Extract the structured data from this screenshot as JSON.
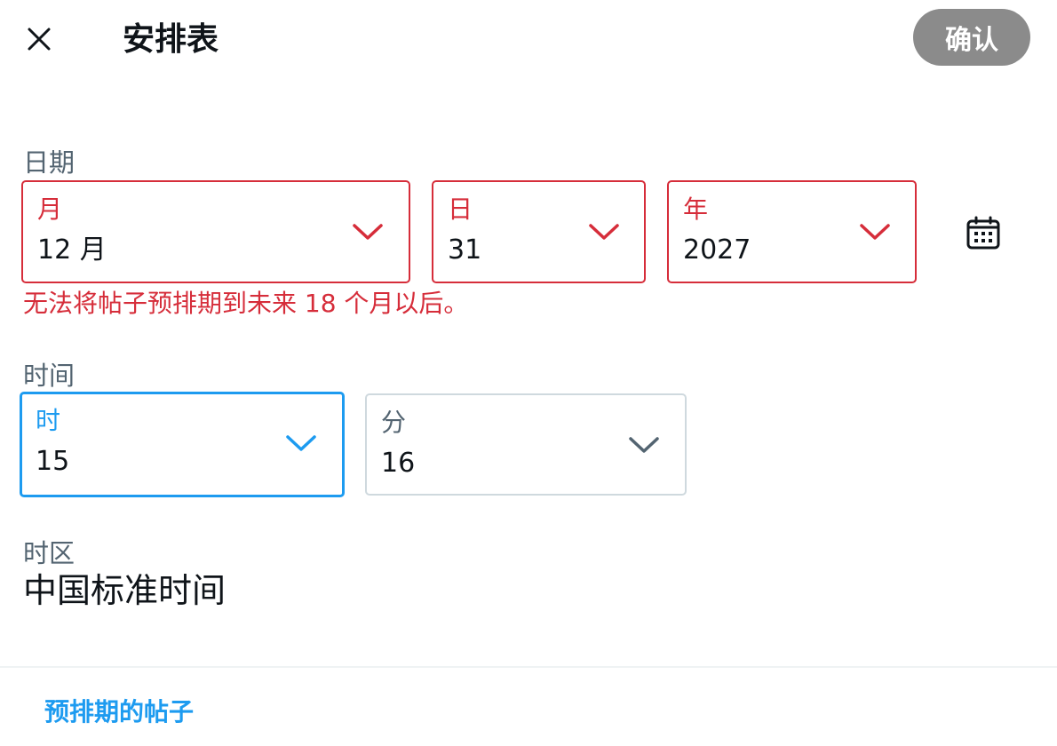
{
  "header": {
    "title": "安排表",
    "confirm_label": "确认"
  },
  "date": {
    "section_label": "日期",
    "month": {
      "label": "月",
      "value": "12 月"
    },
    "day": {
      "label": "日",
      "value": "31"
    },
    "year": {
      "label": "年",
      "value": "2027"
    },
    "error": "无法将帖子预排期到未来 18 个月以后。"
  },
  "time": {
    "section_label": "时间",
    "hour": {
      "label": "时",
      "value": "15"
    },
    "minute": {
      "label": "分",
      "value": "16"
    }
  },
  "timezone": {
    "section_label": "时区",
    "value": "中国标准时间"
  },
  "footer": {
    "scheduled_posts_link": "预排期的帖子"
  },
  "icons": {
    "close": "close-icon",
    "chevron": "chevron-down-icon",
    "calendar": "calendar-icon"
  },
  "colors": {
    "error": "#d62d3a",
    "focus": "#1d9bf0",
    "confirm_disabled": "#8b8b8b",
    "text_primary": "#0f1419",
    "text_secondary": "#536471",
    "border": "#cfd9de"
  }
}
